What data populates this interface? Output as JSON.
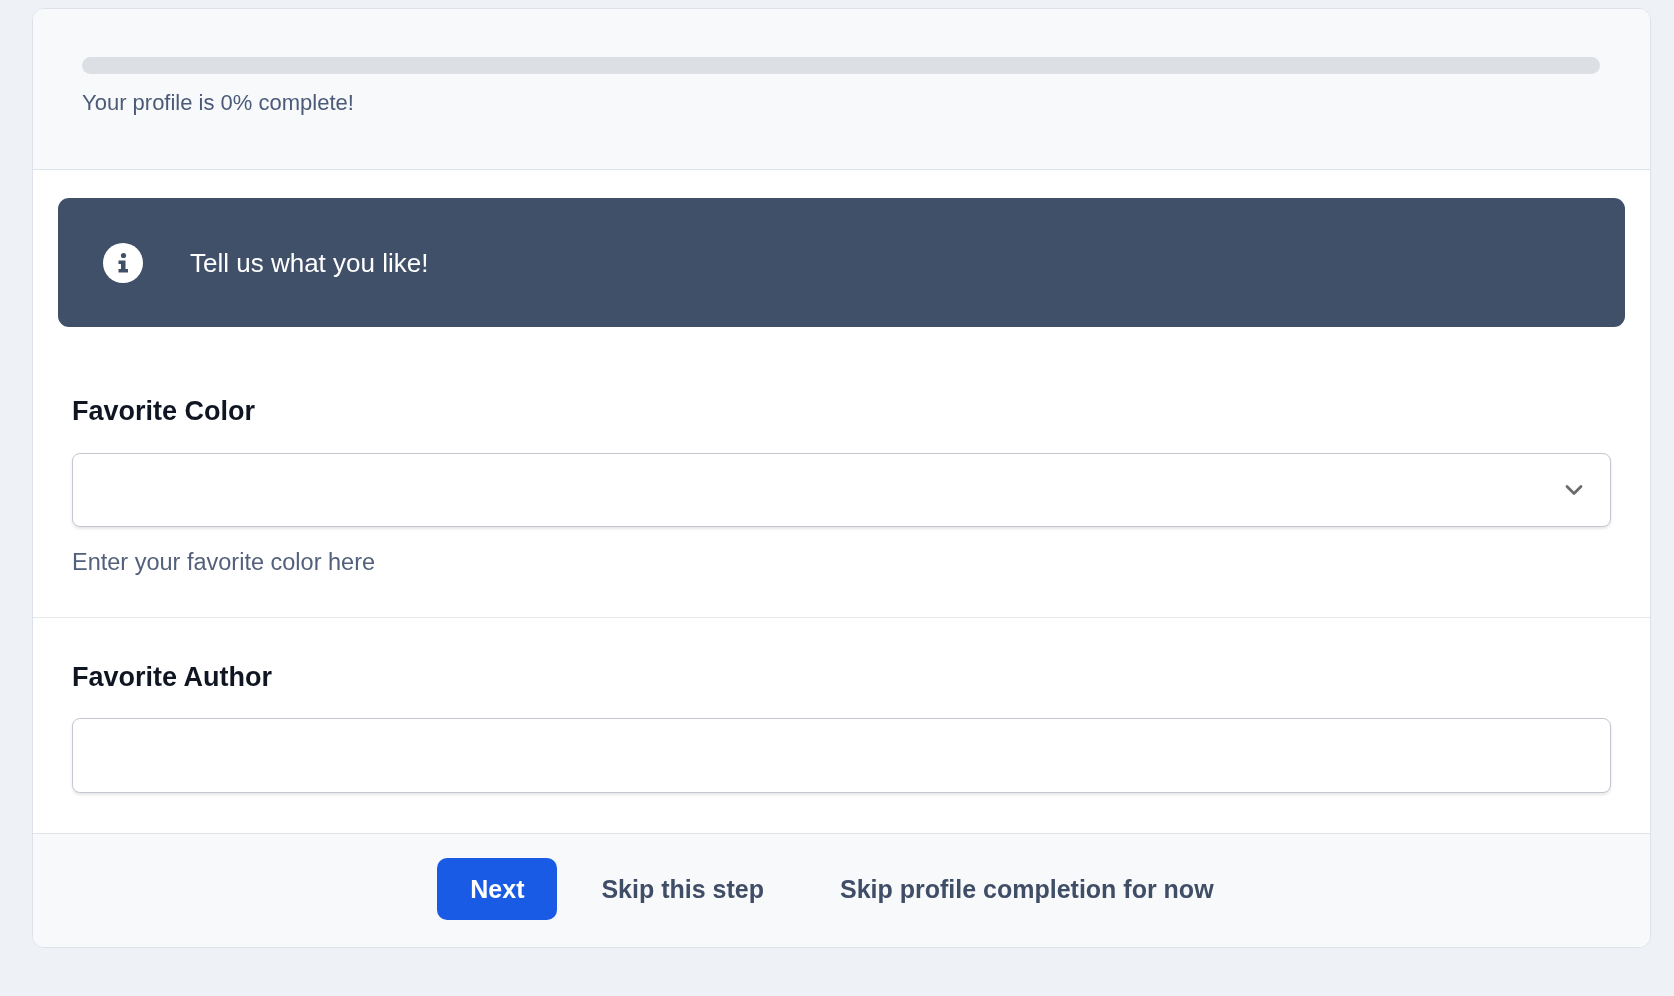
{
  "progress": {
    "level": 0,
    "caption": "Your profile is 0% complete!"
  },
  "alert": {
    "kind": "info",
    "message": "Tell us what you like!"
  },
  "fields": [
    {
      "kind": "select",
      "label": "Favorite Color",
      "help": "Enter your favorite color here"
    },
    {
      "kind": "text",
      "label": "Favorite Author"
    }
  ],
  "actions": [
    {
      "kind": "primary",
      "label": "Next"
    },
    {
      "kind": "link",
      "label": "Skip this step"
    },
    {
      "kind": "link",
      "label": "Skip profile completion for now"
    }
  ]
}
